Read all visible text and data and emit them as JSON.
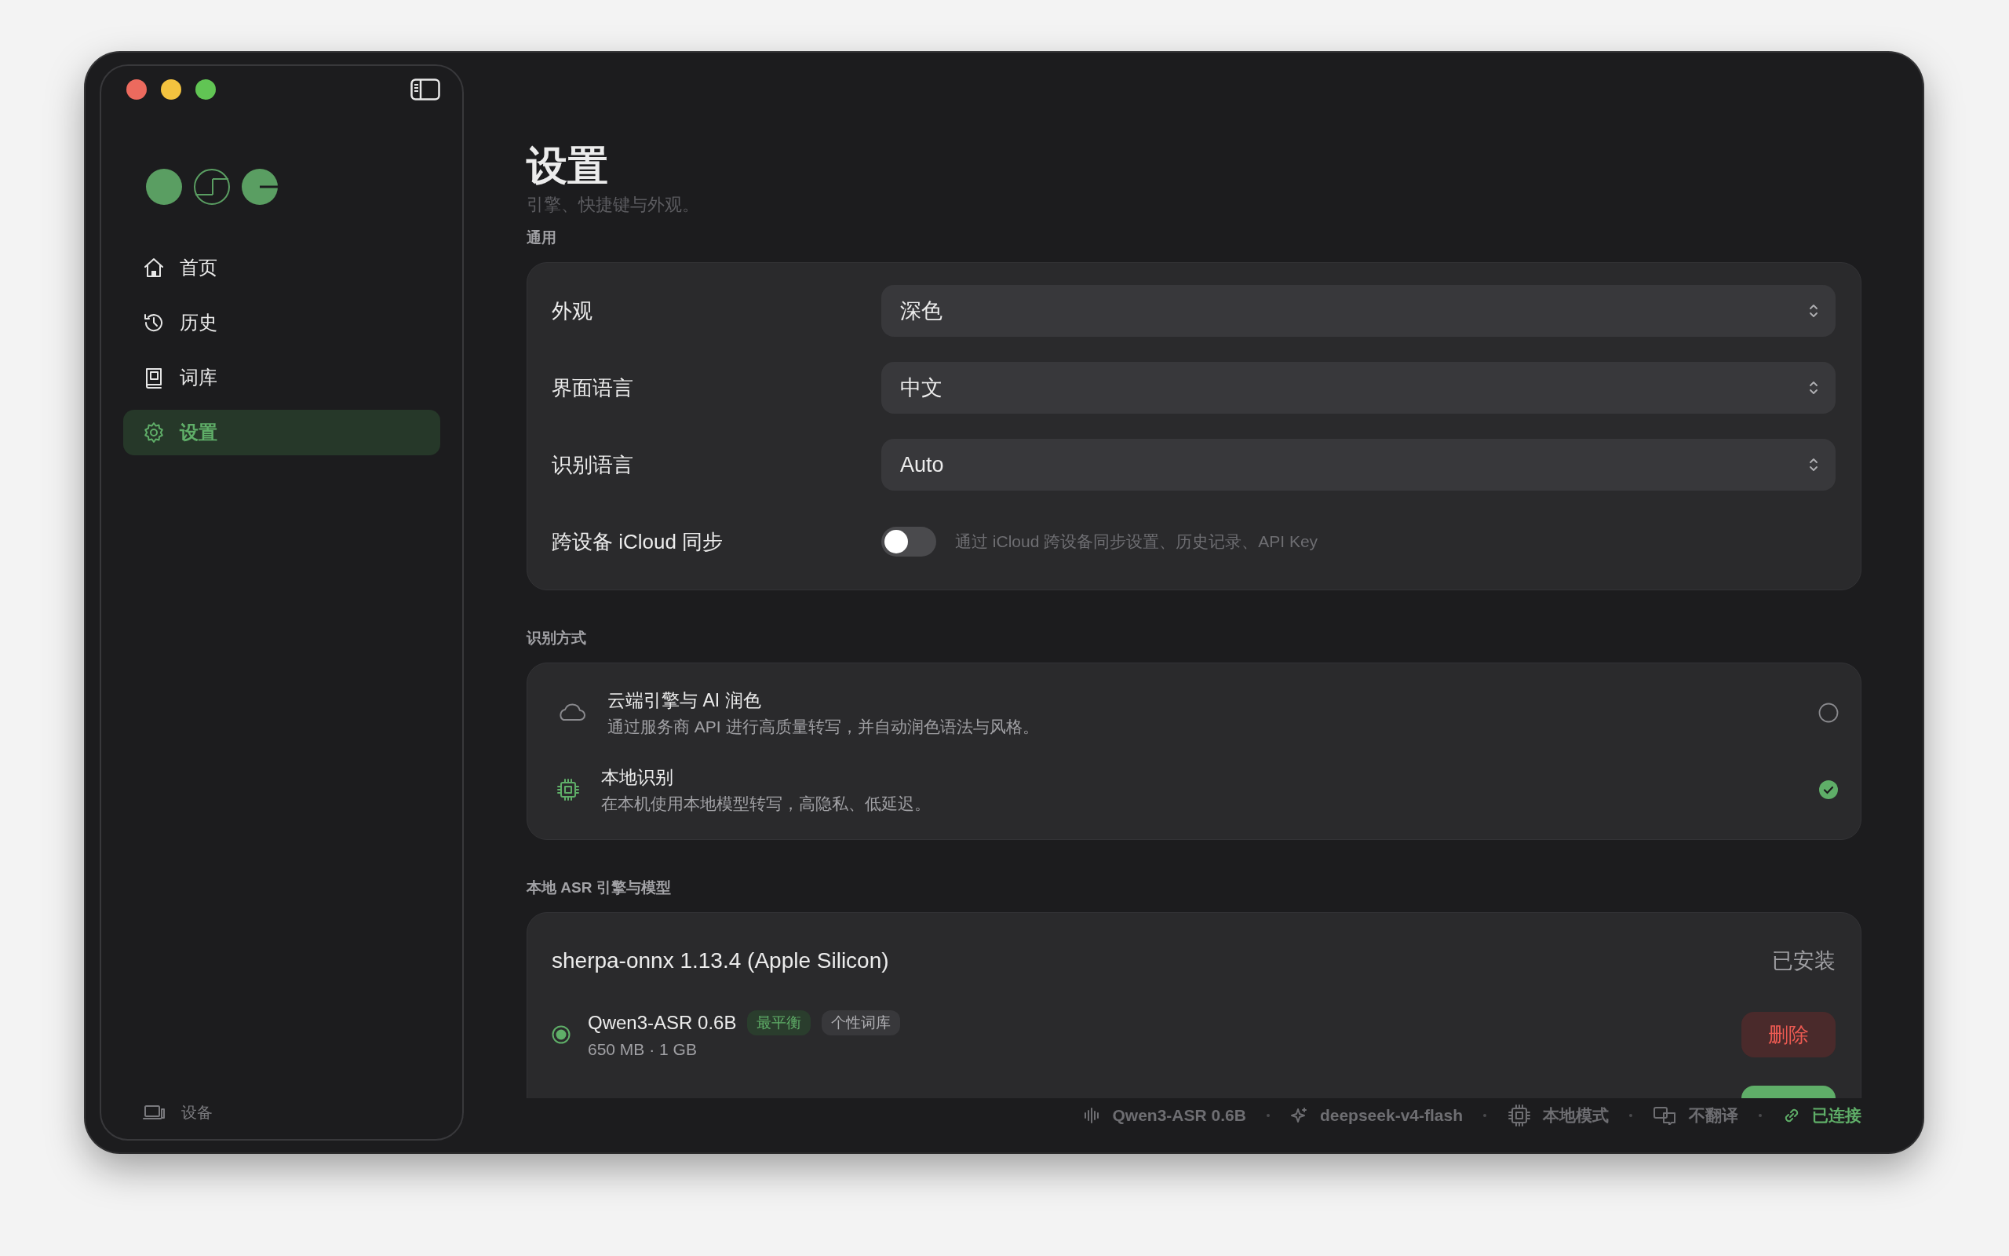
{
  "sidebar": {
    "items": [
      {
        "kind": "home",
        "label": "首页",
        "selected": false
      },
      {
        "kind": "history",
        "label": "历史",
        "selected": false
      },
      {
        "kind": "dictionary",
        "label": "词库",
        "selected": false
      },
      {
        "kind": "settings",
        "label": "设置",
        "selected": true
      }
    ],
    "footer": {
      "kind": "device",
      "label": "设备"
    }
  },
  "page": {
    "title": "设置",
    "subtitle": "引擎、快捷键与外观。"
  },
  "sections": [
    {
      "kind": "settings",
      "heading": "通用",
      "rows": [
        {
          "kind": "select",
          "label": "外观",
          "value": "深色"
        },
        {
          "kind": "select",
          "label": "界面语言",
          "value": "中文"
        },
        {
          "kind": "select",
          "label": "识别语言",
          "value": "Auto"
        },
        {
          "kind": "toggle",
          "label": "跨设备 iCloud 同步",
          "on": false,
          "description": "通过 iCloud 跨设备同步设置、历史记录、API Key"
        }
      ]
    },
    {
      "kind": "modes",
      "heading": "识别方式",
      "options": [
        {
          "kind": "cloud",
          "title": "云端引擎与 AI 润色",
          "description": "通过服务商 API 进行高质量转写，并自动润色语法与风格。",
          "selected": false
        },
        {
          "kind": "chip",
          "title": "本地识别",
          "description": "在本机使用本地模型转写，高隐私、低延迟。",
          "selected": true
        }
      ]
    },
    {
      "kind": "engine",
      "heading": "本地 ASR 引擎与模型",
      "engine": {
        "name": "sherpa-onnx 1.13.4 (Apple Silicon)",
        "status": "已安装"
      },
      "models": [
        {
          "name": "Qwen3-ASR 0.6B",
          "selected": true,
          "tags": [
            {
              "kind": "accent",
              "label": "最平衡"
            },
            {
              "kind": "plain",
              "label": "个性词库"
            }
          ],
          "size": "650 MB · 1 GB",
          "action": {
            "kind": "delete",
            "label": "删除"
          }
        },
        {
          "action": {
            "kind": "primary"
          }
        }
      ]
    }
  ],
  "status_bar": {
    "items": [
      {
        "kind": "waveform",
        "label": "Qwen3-ASR 0.6B",
        "ok": false
      },
      {
        "kind": "sparkle",
        "label": "deepseek-v4-flash",
        "ok": false
      },
      {
        "kind": "chip",
        "label": "本地模式",
        "ok": false
      },
      {
        "kind": "translate",
        "label": "不翻译",
        "ok": false
      },
      {
        "kind": "link",
        "label": "已连接",
        "ok": true
      }
    ]
  }
}
